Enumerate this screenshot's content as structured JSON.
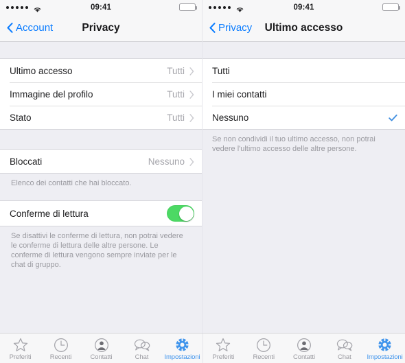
{
  "status_bar": {
    "carrier_dots": 5,
    "wifi_icon": "wifi-icon",
    "time": "09:41",
    "battery_icon": "battery-full-icon"
  },
  "left_screen": {
    "nav": {
      "back_label": "Account",
      "back_icon": "chevron-left-icon",
      "title": "Privacy"
    },
    "group_privacy": [
      {
        "label": "Ultimo accesso",
        "value": "Tutti",
        "accessory": "chevron-right-icon"
      },
      {
        "label": "Immagine del profilo",
        "value": "Tutti",
        "accessory": "chevron-right-icon"
      },
      {
        "label": "Stato",
        "value": "Tutti",
        "accessory": "chevron-right-icon"
      }
    ],
    "group_blocked": [
      {
        "label": "Bloccati",
        "value": "Nessuno",
        "accessory": "chevron-right-icon"
      }
    ],
    "blocked_footnote": "Elenco dei contatti che hai bloccato.",
    "group_receipts": [
      {
        "label": "Conferme di lettura",
        "toggle": "on"
      }
    ],
    "receipts_footnote": "Se disattivi le conferme di lettura, non potrai vedere le conferme di lettura delle altre persone. Le conferme di lettura vengono sempre inviate per le chat di gruppo."
  },
  "right_screen": {
    "nav": {
      "back_label": "Privacy",
      "back_icon": "chevron-left-icon",
      "title": "Ultimo accesso"
    },
    "options": [
      {
        "label": "Tutti",
        "selected": false
      },
      {
        "label": "I miei contatti",
        "selected": false
      },
      {
        "label": "Nessuno",
        "selected": true
      }
    ],
    "footnote": "Se non condividi il tuo ultimo accesso, non potrai vedere l'ultimo accesso delle altre persone."
  },
  "tab_bar": {
    "tabs": [
      {
        "label": "Preferiti",
        "icon": "star-icon",
        "active": false
      },
      {
        "label": "Recenti",
        "icon": "clock-icon",
        "active": false
      },
      {
        "label": "Contatti",
        "icon": "person-circle-icon",
        "active": false
      },
      {
        "label": "Chat",
        "icon": "speech-bubbles-icon",
        "active": false
      },
      {
        "label": "Impostazioni",
        "icon": "settings-gear-icon",
        "active": true
      }
    ]
  },
  "colors": {
    "accent_blue": "#0a7cff",
    "toggle_green": "#4cd964",
    "check_blue": "#3f8ee0",
    "tab_active": "#3f94ec",
    "background": "#eeeef3"
  }
}
